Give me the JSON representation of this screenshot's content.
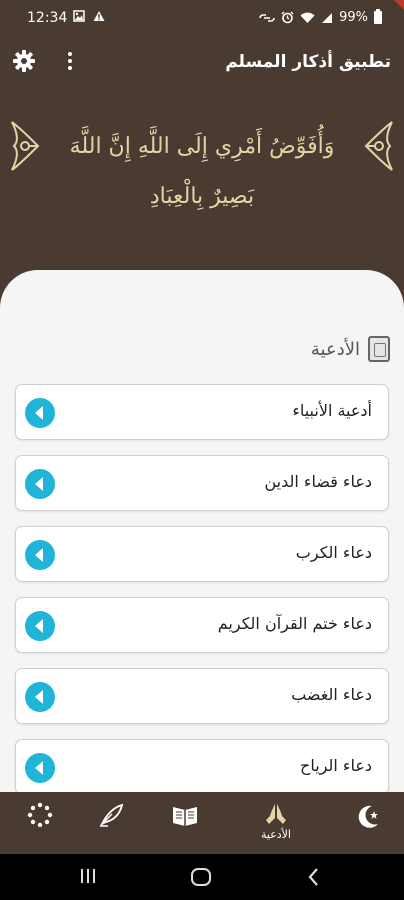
{
  "status": {
    "time": "12:34",
    "left_icons": "🖻⚠",
    "battery": "99%"
  },
  "appbar": {
    "title": "تطبيق أذكار المسلم",
    "settings_icon": "gear-icon",
    "menu_icon": "kebab-menu-icon"
  },
  "verse": {
    "text": "وَأُفَوِّضُ أَمْرِي إِلَى اللَّهِ إِنَّ اللَّهَ بَصِيرٌ بِالْعِبَادِ"
  },
  "section": {
    "title": "الأدعية",
    "icon": "quran-book-icon"
  },
  "items": [
    {
      "label": "أدعية الأنبياء"
    },
    {
      "label": "دعاء قضاء الدين"
    },
    {
      "label": "دعاء الكرب"
    },
    {
      "label": "دعاء ختم القرآن الكريم"
    },
    {
      "label": "دعاء الغضب"
    },
    {
      "label": "دعاء الرياح"
    }
  ],
  "bottom_nav": [
    {
      "icon": "tasbih-icon",
      "label": ""
    },
    {
      "icon": "quill-icon",
      "label": ""
    },
    {
      "icon": "quran-icon",
      "label": ""
    },
    {
      "icon": "praying-hands-icon",
      "label": "الأدعية",
      "active": true
    },
    {
      "icon": "crescent-star-icon",
      "label": ""
    }
  ],
  "colors": {
    "primary": "#4a3b32",
    "accent": "#1fb4d8",
    "verse": "#e6d3a3",
    "sheet": "#f5f5f5"
  }
}
